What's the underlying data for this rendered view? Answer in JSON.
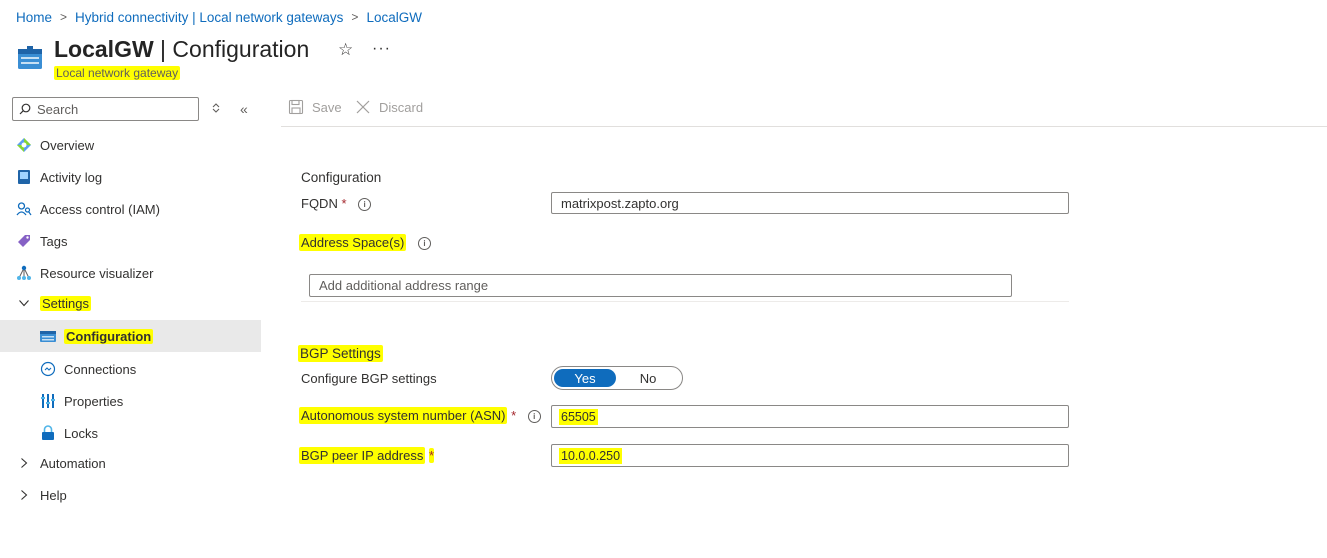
{
  "breadcrumb": [
    "Home",
    "Hybrid connectivity | Local network gateways",
    "LocalGW"
  ],
  "header": {
    "title_bold": "LocalGW",
    "title_rest": " | Configuration",
    "subtitle": "Local network gateway",
    "fav_icon": "☆",
    "more_icon": "···"
  },
  "search": {
    "placeholder": "Search"
  },
  "sidebar": {
    "items": [
      {
        "label": "Overview",
        "icon": "overview-icon"
      },
      {
        "label": "Activity log",
        "icon": "activity-log-icon"
      },
      {
        "label": "Access control (IAM)",
        "icon": "iam-icon"
      },
      {
        "label": "Tags",
        "icon": "tag-icon"
      },
      {
        "label": "Resource visualizer",
        "icon": "visualizer-icon"
      },
      {
        "label": "Settings",
        "icon": "chevron-down-icon"
      },
      {
        "label": "Configuration",
        "icon": "configuration-icon",
        "active": true
      },
      {
        "label": "Connections",
        "icon": "connections-icon"
      },
      {
        "label": "Properties",
        "icon": "properties-icon"
      },
      {
        "label": "Locks",
        "icon": "lock-icon"
      },
      {
        "label": "Automation",
        "icon": "chevron-right-icon"
      },
      {
        "label": "Help",
        "icon": "chevron-right-icon"
      }
    ]
  },
  "toolbar": {
    "save_label": "Save",
    "discard_label": "Discard"
  },
  "form": {
    "section_configuration": "Configuration",
    "fqdn_label": "FQDN",
    "fqdn_value": "matrixpost.zapto.org",
    "address_space_label": "Address Space(s)",
    "address_range_placeholder": "Add additional address range",
    "section_bgp": "BGP Settings",
    "configure_bgp_label": "Configure BGP settings",
    "toggle_yes": "Yes",
    "toggle_no": "No",
    "toggle_selected": "Yes",
    "asn_label": "Autonomous system number (ASN)",
    "asn_value": "65505",
    "bgp_peer_label": "BGP peer IP address",
    "bgp_peer_value": "10.0.0.250",
    "required_mark": "*"
  },
  "colors": {
    "accent": "#0f6cbd",
    "highlight": "#ffff00",
    "required": "#a4262c"
  }
}
